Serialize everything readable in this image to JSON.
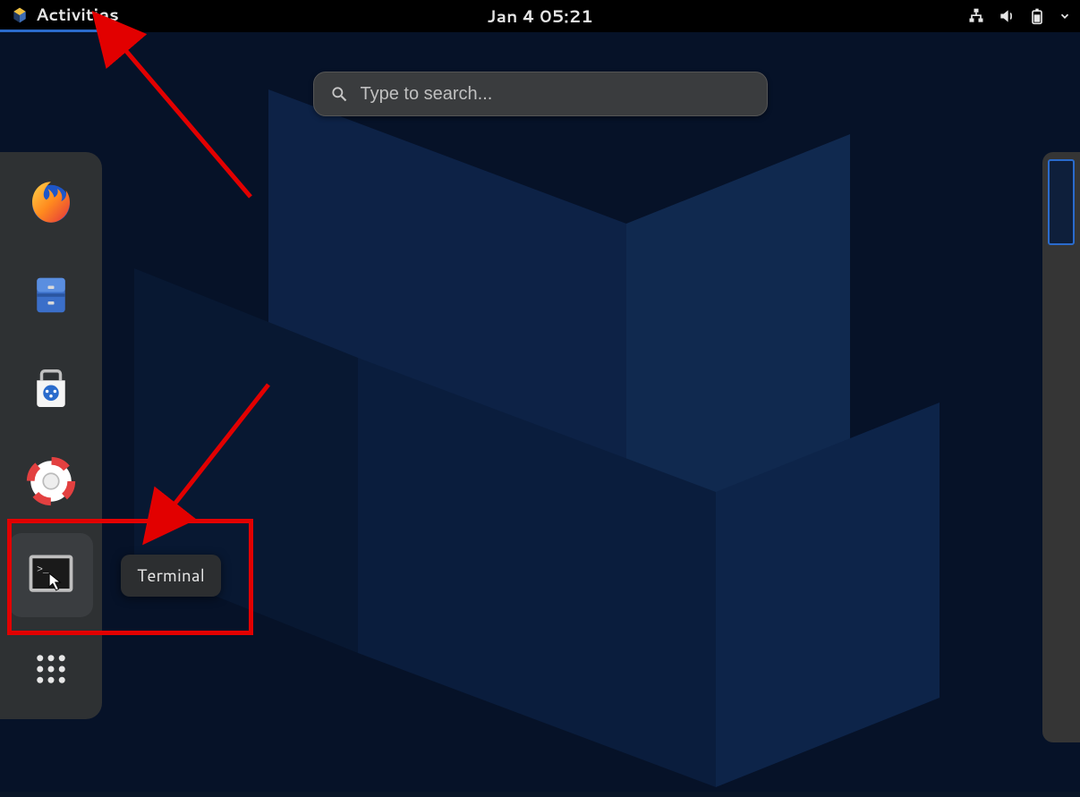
{
  "topbar": {
    "activities_label": "Activities",
    "clock_text": "Jan 4  05:21"
  },
  "search": {
    "placeholder": "Type to search..."
  },
  "dock": {
    "items": [
      {
        "name": "firefox-icon"
      },
      {
        "name": "files-icon"
      },
      {
        "name": "software-icon"
      },
      {
        "name": "help-icon"
      },
      {
        "name": "terminal-icon"
      },
      {
        "name": "show-apps-icon"
      }
    ]
  },
  "tooltip": {
    "terminal_label": "Terminal"
  },
  "status": {
    "network": "wired",
    "volume": "on",
    "battery": "full"
  },
  "colors": {
    "accent": "#2a6bcc",
    "annotation": "#e20000",
    "panel": "#2e3133"
  }
}
